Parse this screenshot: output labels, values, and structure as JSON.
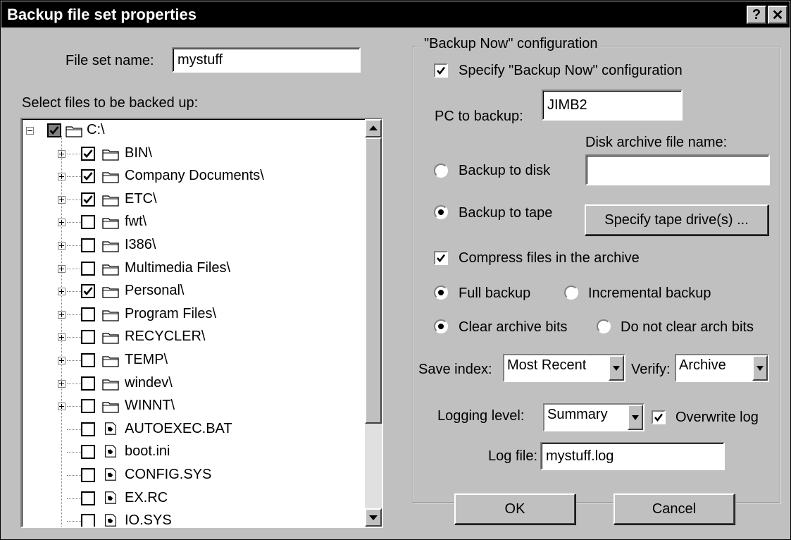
{
  "window": {
    "title": "Backup file set properties",
    "help_label": "?",
    "close_label": "✕"
  },
  "file_set": {
    "label": "File set name:",
    "value": "mystuff"
  },
  "select_files_label": "Select files to be backed up:",
  "tree": {
    "root": {
      "name": "C:\\",
      "checked": "partial",
      "expander": "minus"
    },
    "items": [
      {
        "name": "BIN\\",
        "checked": true,
        "type": "folder"
      },
      {
        "name": "Company Documents\\",
        "checked": true,
        "type": "folder"
      },
      {
        "name": "ETC\\",
        "checked": true,
        "type": "folder"
      },
      {
        "name": "fwt\\",
        "checked": false,
        "type": "folder"
      },
      {
        "name": "I386\\",
        "checked": false,
        "type": "folder"
      },
      {
        "name": "Multimedia Files\\",
        "checked": false,
        "type": "folder"
      },
      {
        "name": "Personal\\",
        "checked": true,
        "type": "folder"
      },
      {
        "name": "Program Files\\",
        "checked": false,
        "type": "folder"
      },
      {
        "name": "RECYCLER\\",
        "checked": false,
        "type": "folder"
      },
      {
        "name": "TEMP\\",
        "checked": false,
        "type": "folder"
      },
      {
        "name": "windev\\",
        "checked": false,
        "type": "folder"
      },
      {
        "name": "WINNT\\",
        "checked": false,
        "type": "folder"
      },
      {
        "name": "AUTOEXEC.BAT",
        "checked": false,
        "type": "file"
      },
      {
        "name": "boot.ini",
        "checked": false,
        "type": "file"
      },
      {
        "name": "CONFIG.SYS",
        "checked": false,
        "type": "file"
      },
      {
        "name": "EX.RC",
        "checked": false,
        "type": "file"
      },
      {
        "name": "IO.SYS",
        "checked": false,
        "type": "file"
      }
    ]
  },
  "config": {
    "group_label": "\"Backup Now\" configuration",
    "specify_label": "Specify \"Backup Now\" configuration",
    "specify_checked": true,
    "pc_label": "PC to backup:",
    "pc_value": "JIMB2",
    "disk_archive_label": "Disk archive file name:",
    "disk_archive_value": "",
    "backup_disk_label": "Backup to disk",
    "backup_tape_label": "Backup to tape",
    "backup_target": "tape",
    "tape_button_label": "Specify tape drive(s) ...",
    "compress_label": "Compress files in the archive",
    "compress_checked": true,
    "full_label": "Full backup",
    "incremental_label": "Incremental backup",
    "backup_type": "full",
    "clear_label": "Clear archive bits",
    "noclear_label": "Do not clear arch bits",
    "archive_bits": "clear",
    "save_index_label": "Save index:",
    "save_index_value": "Most Recent",
    "verify_label": "Verify:",
    "verify_value": "Archive",
    "logging_label": "Logging level:",
    "logging_value": "Summary",
    "overwrite_label": "Overwrite log",
    "overwrite_checked": true,
    "logfile_label": "Log file:",
    "logfile_value": "mystuff.log"
  },
  "buttons": {
    "ok": "OK",
    "cancel": "Cancel"
  }
}
